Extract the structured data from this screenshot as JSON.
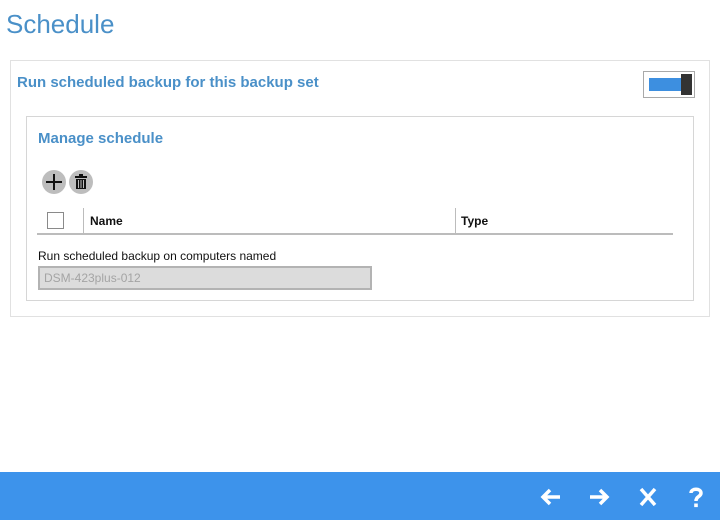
{
  "page": {
    "title": "Schedule"
  },
  "schedule": {
    "heading": "Run scheduled backup for this backup set",
    "toggle_on": true
  },
  "manage": {
    "heading": "Manage schedule",
    "table": {
      "columns": [
        "Name",
        "Type"
      ],
      "rows": []
    },
    "computer_label": "Run scheduled backup on computers named",
    "computer_value": "DSM-423plus-012"
  },
  "icons": {
    "add": "plus-icon",
    "delete": "trash-icon",
    "back": "arrow-left-icon",
    "next": "arrow-right-icon",
    "close": "close-icon",
    "help": "help-icon"
  },
  "colors": {
    "accent": "#4a90c8",
    "footer": "#3d93eb",
    "toggle_track": "#3d8fe0"
  }
}
